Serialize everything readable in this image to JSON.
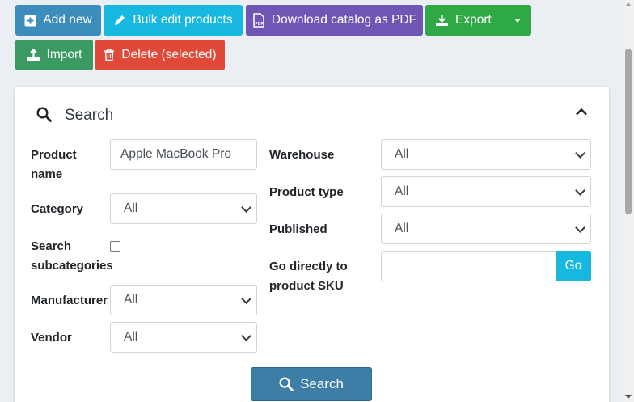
{
  "toolbar": {
    "add_new": "Add new",
    "bulk_edit": "Bulk edit products",
    "download_pdf": "Download catalog as PDF",
    "export": "Export",
    "import": "Import",
    "delete_selected": "Delete (selected)"
  },
  "search_panel": {
    "title": "Search",
    "product_name_label": "Product name",
    "product_name_value": "Apple MacBook Pro",
    "category_label": "Category",
    "category_value": "All",
    "search_subcategories_label": "Search subcategories",
    "search_subcategories_checked": false,
    "manufacturer_label": "Manufacturer",
    "manufacturer_value": "All",
    "vendor_label": "Vendor",
    "vendor_value": "All",
    "warehouse_label": "Warehouse",
    "warehouse_value": "All",
    "product_type_label": "Product type",
    "product_type_value": "All",
    "published_label": "Published",
    "published_value": "All",
    "sku_label": "Go directly to product SKU",
    "sku_value": "",
    "go_button": "Go",
    "search_button": "Search"
  },
  "icons": {
    "add": "plus-square-icon",
    "bulk": "pencil-icon",
    "pdf": "pdf-file-icon",
    "export": "download-icon",
    "import": "upload-icon",
    "delete": "trash-icon",
    "search": "search-icon",
    "collapse": "chevron-up-icon"
  }
}
